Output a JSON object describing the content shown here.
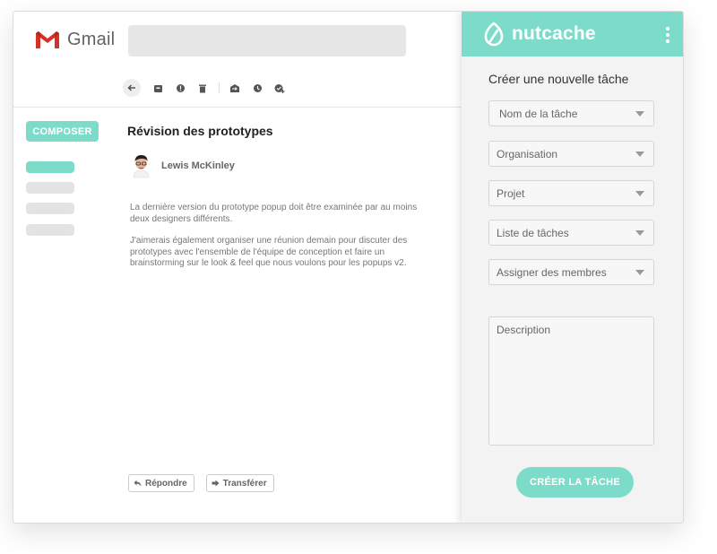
{
  "gmail": {
    "logo_text": "Gmail",
    "search": {
      "placeholder": ""
    },
    "toolbar_icons": [
      "back-arrow-icon",
      "archive-icon",
      "report-spam-icon",
      "delete-icon",
      "move-to-icon",
      "snooze-icon",
      "add-task-icon"
    ],
    "compose_label": "COMPOSER",
    "email": {
      "subject": "Révision des prototypes",
      "sender": "Lewis McKinley",
      "paragraphs": [
        "La dernière version du prototype popup doit être examinée par au moins deux designers différents.",
        "J'aimerais également organiser une réunion demain pour discuter des prototypes avec l'ensemble de l'équipe de conception et faire un brainstorming sur le look & feel que nous voulons pour les popups v2."
      ],
      "reply_label": "Répondre",
      "forward_label": "Transférer"
    }
  },
  "nutcache": {
    "logo_text": "nutcache",
    "panel_title": "Créer une nouvelle tâche",
    "fields": {
      "task_name": "Nom de la tâche",
      "organisation": "Organisation",
      "project": "Projet",
      "task_list": "Liste de tâches",
      "assign_members": "Assigner des membres"
    },
    "description_placeholder": "Description",
    "create_button": "CRÉER LA TÂCHE"
  },
  "colors": {
    "accent": "#7ddcc9",
    "gmail_red": "#d93025",
    "panel_bg": "#f3f3f3"
  }
}
